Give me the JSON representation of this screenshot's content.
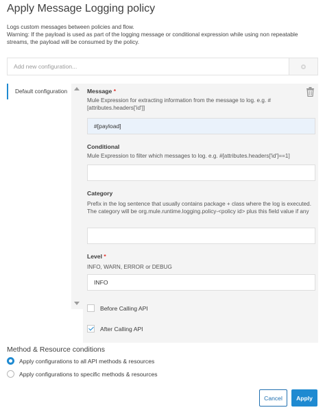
{
  "header": {
    "title": "Apply Message Logging policy",
    "description_line1": "Logs custom messages between policies and flow.",
    "description_warning": "Warning: If the payload is used as part of the logging message or conditional expression while using non repeatable streams, the payload will be consumed by the policy."
  },
  "add_config": {
    "placeholder": "Add new configuration...",
    "icon": "gear-icon"
  },
  "configurations": [
    {
      "label": "Default configuration"
    }
  ],
  "form": {
    "message": {
      "label": "Message",
      "required_mark": "*",
      "help": "Mule Expression for extracting information from the message to log. e.g. #[attributes.headers['id']]",
      "value": "#[payload]"
    },
    "conditional": {
      "label": "Conditional",
      "help": "Mule Expression to filter which messages to log. e.g. #[attributes.headers['id']==1]",
      "value": ""
    },
    "category": {
      "label": "Category",
      "help": "Prefix in the log sentence that usually contains package + class where the log is executed. The category will be org.mule.runtime.logging.policy-<policy id> plus this field value if any",
      "value": ""
    },
    "level": {
      "label": "Level",
      "required_mark": "*",
      "help": "INFO, WARN, ERROR or DEBUG",
      "value": "INFO"
    },
    "before_calling_api": {
      "label": "Before Calling API",
      "checked": false
    },
    "after_calling_api": {
      "label": "After Calling API",
      "checked": true
    }
  },
  "method_resource": {
    "title": "Method & Resource conditions",
    "options": [
      {
        "label": "Apply configurations to all API methods & resources",
        "selected": true
      },
      {
        "label": "Apply configurations to specific methods & resources",
        "selected": false
      }
    ]
  },
  "actions": {
    "cancel_label": "Cancel",
    "apply_label": "Apply"
  },
  "colors": {
    "accent": "#1f8ad1",
    "required": "#e0322d",
    "panel_bg": "#f4f4f4"
  }
}
